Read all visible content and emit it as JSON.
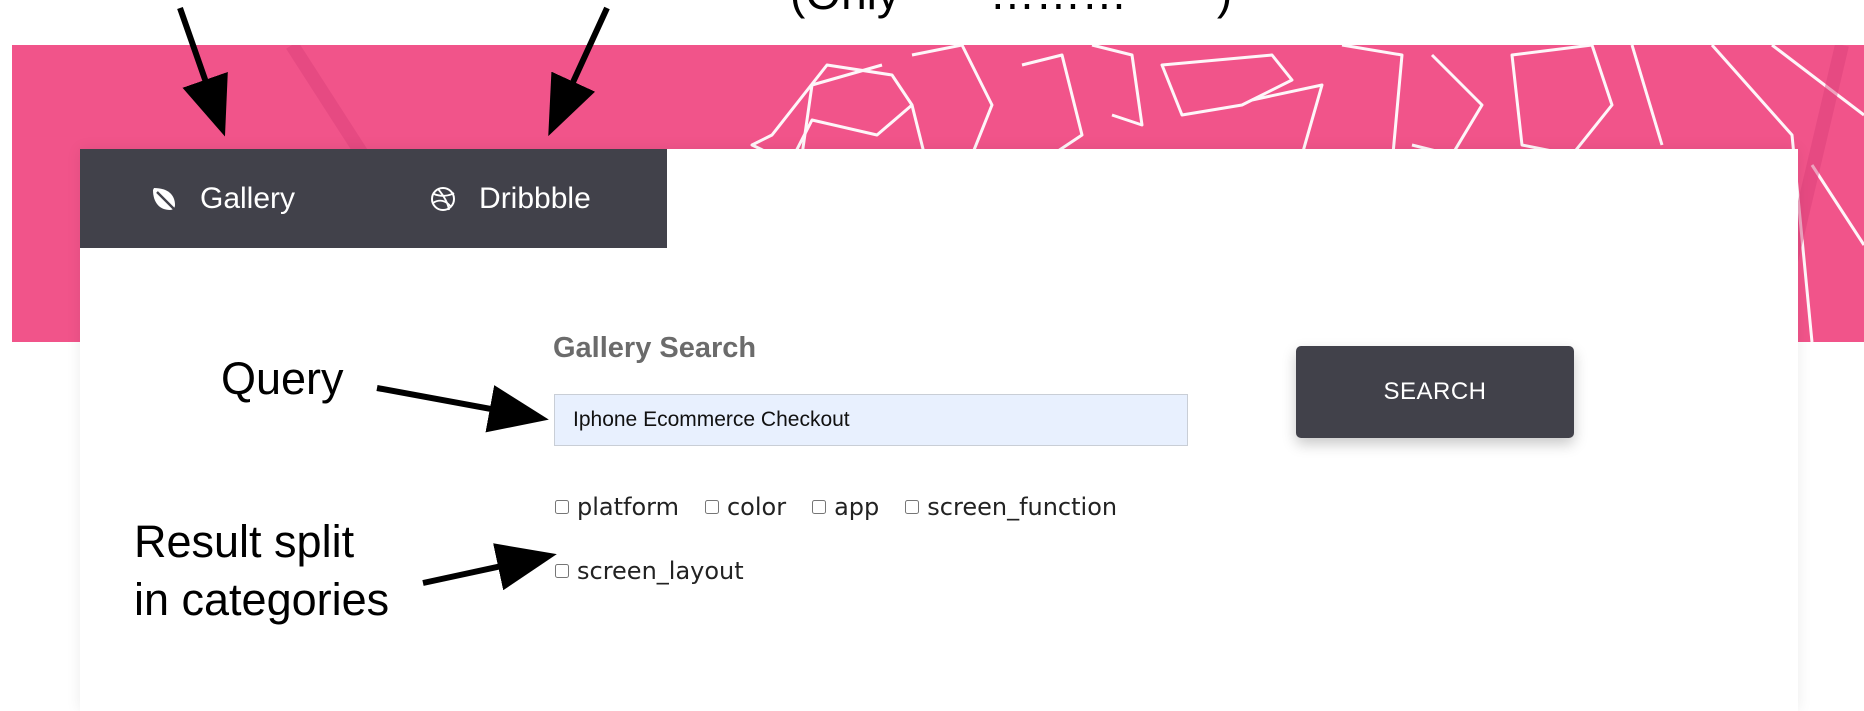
{
  "annotations": {
    "top_cut": "(Only       ………       )",
    "query": "Query",
    "result_line1": "Result split",
    "result_line2": "in categories"
  },
  "nav": {
    "gallery_label": "Gallery",
    "dribbble_label": "Dribbble",
    "gallery_icon": "leaf-icon",
    "dribbble_icon": "dribbble-icon"
  },
  "search": {
    "title": "Gallery Search",
    "query_value": "Iphone Ecommerce Checkout",
    "button_label": "SEARCH"
  },
  "categories": [
    {
      "label": "platform",
      "checked": false
    },
    {
      "label": "color",
      "checked": false
    },
    {
      "label": "app",
      "checked": false
    },
    {
      "label": "screen_function",
      "checked": false
    },
    {
      "label": "screen_layout",
      "checked": false
    }
  ],
  "colors": {
    "banner": "#f1548a",
    "nav_bg": "#41414a",
    "input_bg": "#e8f0fe"
  }
}
